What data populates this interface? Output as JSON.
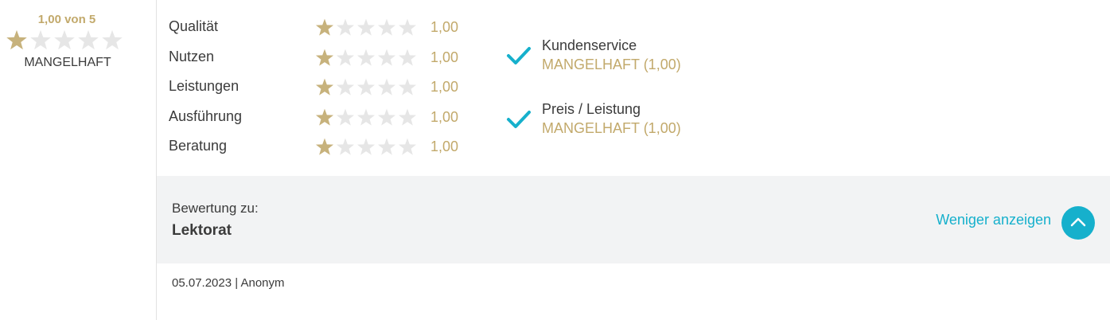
{
  "overall": {
    "score_text": "1,00 von 5",
    "rating": 1,
    "max": 5,
    "label": "MANGELHAFT"
  },
  "criteria": [
    {
      "label": "Qualität",
      "rating": 1,
      "value": "1,00"
    },
    {
      "label": "Nutzen",
      "rating": 1,
      "value": "1,00"
    },
    {
      "label": "Leistungen",
      "rating": 1,
      "value": "1,00"
    },
    {
      "label": "Ausführung",
      "rating": 1,
      "value": "1,00"
    },
    {
      "label": "Beratung",
      "rating": 1,
      "value": "1,00"
    }
  ],
  "flags": [
    {
      "title": "Kundenservice",
      "value": "MANGELHAFT (1,00)",
      "icon": "check-icon"
    },
    {
      "title": "Preis / Leistung",
      "value": "MANGELHAFT (1,00)",
      "icon": "check-icon"
    }
  ],
  "review_for": {
    "label": "Bewertung zu:",
    "value": "Lektorat"
  },
  "toggle": {
    "label": "Weniger anzeigen",
    "icon": "chevron-up-icon"
  },
  "meta": {
    "text": "05.07.2023 | Anonym"
  },
  "colors": {
    "gold": "#c2a96b",
    "star_filled": "#c7b27c",
    "star_empty": "#e6e6e6",
    "accent": "#16b0cc",
    "band": "#f2f3f4"
  }
}
